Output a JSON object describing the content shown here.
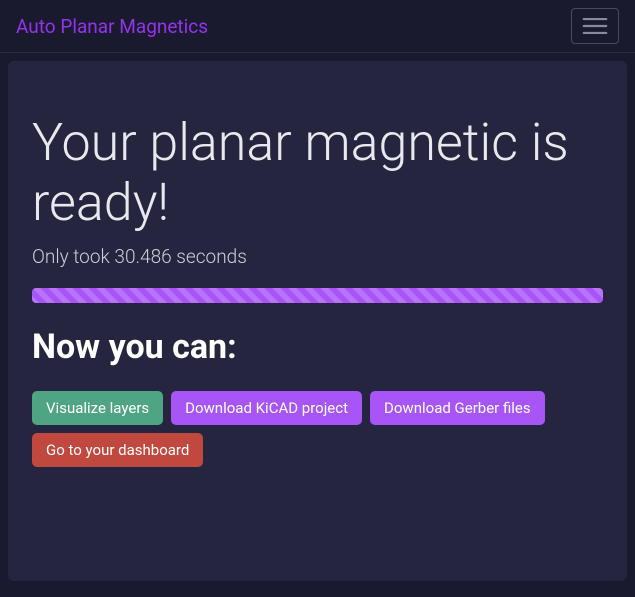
{
  "nav": {
    "brand": "Auto Planar Magnetics"
  },
  "card": {
    "title": "Your planar magnetic is ready!",
    "subtitle": "Only took 30.486 seconds",
    "section_title": "Now you can:",
    "progress_percent": 100
  },
  "buttons": {
    "visualize": "Visualize layers",
    "kicad": "Download KiCAD project",
    "gerber": "Download Gerber files",
    "dashboard": "Go to your dashboard"
  },
  "colors": {
    "accent_purple": "#a855f7",
    "brand_purple": "#9333ea",
    "success_green": "#4fa583",
    "danger_red": "#c0483f",
    "bg_dark": "#1a1a2e",
    "card_bg": "#252540"
  }
}
